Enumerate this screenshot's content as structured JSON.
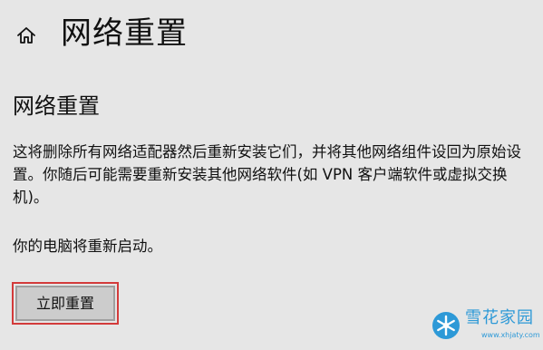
{
  "header": {
    "page_title": "网络重置",
    "home_icon": "home-icon"
  },
  "content": {
    "section_title": "网络重置",
    "description": "这将删除所有网络适配器然后重新安装它们，并将其他网络组件设回为原始设置。你随后可能需要重新安装其他网络软件(如 VPN 客户端软件或虚拟交换机)。",
    "restart_note": "你的电脑将重新启动。",
    "reset_button_label": "立即重置"
  },
  "watermark": {
    "name": "雪花家园",
    "url": "www.xhjaty.com",
    "icon": "snowflake-icon"
  },
  "colors": {
    "background": "#e6e6e6",
    "text": "#111111",
    "button_background": "#cccccc",
    "button_border": "#9f9f9f",
    "highlight_border": "#d33b3b",
    "watermark": "#1e93d6"
  }
}
